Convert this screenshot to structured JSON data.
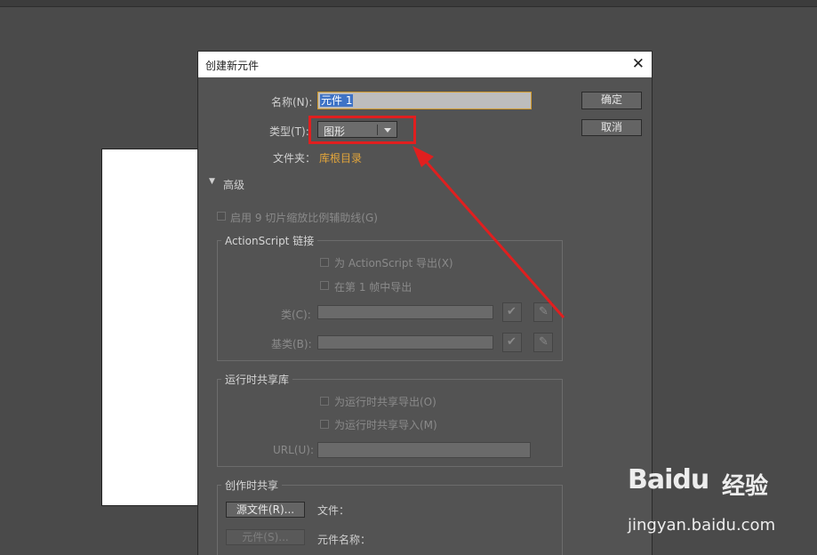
{
  "dialog": {
    "title": "创建新元件",
    "name_label": "名称(N):",
    "name_value": "元件 1",
    "type_label": "类型(T):",
    "type_value": "图形",
    "folder_label": "文件夹：",
    "folder_value": "库根目录",
    "ok_label": "确定",
    "cancel_label": "取消",
    "advanced_label": "高级",
    "enable_9slice": "启用 9 切片缩放比例辅助线(G)",
    "actionscript": {
      "title": "ActionScript 链接",
      "export_as": "为 ActionScript 导出(X)",
      "export_frame1": "在第 1 帧中导出",
      "class_label": "类(C):",
      "base_class_label": "基类(B):"
    },
    "runtime_sharing": {
      "title": "运行时共享库",
      "export": "为运行时共享导出(O)",
      "import": "为运行时共享导入(M)",
      "url_label": "URL(U):"
    },
    "authortime": {
      "title": "创作时共享",
      "source_file_button": "源文件(R)...",
      "file_label": "文件：",
      "symbol_button": "元件(S)...",
      "symbol_name_label": "元件名称："
    }
  },
  "watermark": {
    "logo": "Baidu",
    "jingyan": "经验",
    "url": "jingyan.baidu.com"
  },
  "colors": {
    "highlight": "#e01f1f",
    "folder": "#e2a53b",
    "selection": "#3f73c6"
  }
}
